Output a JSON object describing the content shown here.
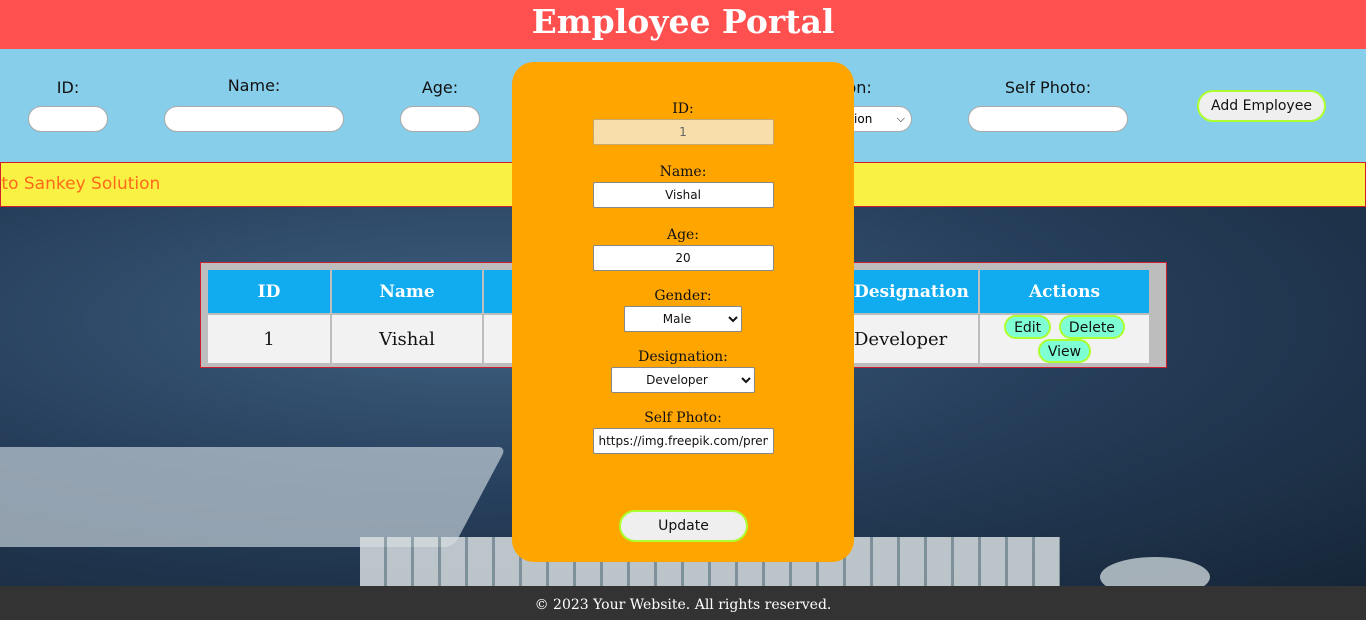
{
  "header": {
    "title": "Employee Portal"
  },
  "form": {
    "id_label": "ID:",
    "name_label": "Name:",
    "age_label": "Age:",
    "designation_label_partial": "ion:",
    "designation_select_partial": "ation",
    "photo_label": "Self Photo:",
    "add_button": "Add Employee"
  },
  "marquee": {
    "text": "me to Sankey Solution"
  },
  "table": {
    "headers": [
      "ID",
      "Name",
      "",
      "Designation",
      "Actions"
    ],
    "rows": [
      {
        "id": "1",
        "name": "Vishal",
        "designation": "Developer"
      }
    ],
    "actions": {
      "edit": "Edit",
      "delete": "Delete",
      "view": "View"
    }
  },
  "modal": {
    "id_label": "ID:",
    "id_value": "1",
    "name_label": "Name:",
    "name_value": "Vishal",
    "age_label": "Age:",
    "age_value": "20",
    "gender_label": "Gender:",
    "gender_value": "Male",
    "designation_label": "Designation:",
    "designation_value": "Developer",
    "photo_label": "Self Photo:",
    "photo_value": "https://img.freepik.com/prem",
    "update_button": "Update"
  },
  "footer": {
    "text": "© 2023 Your Website. All rights reserved."
  },
  "colors": {
    "header_bg": "#ff5050",
    "formbar_bg": "#87ceeb",
    "marquee_bg": "#f9f244",
    "marquee_text": "#ff6a1a",
    "table_header_bg": "#11abef",
    "modal_bg": "#ffa500",
    "action_button_bg": "#7fffd4",
    "button_border": "#adff2f",
    "footer_bg": "#333333"
  }
}
